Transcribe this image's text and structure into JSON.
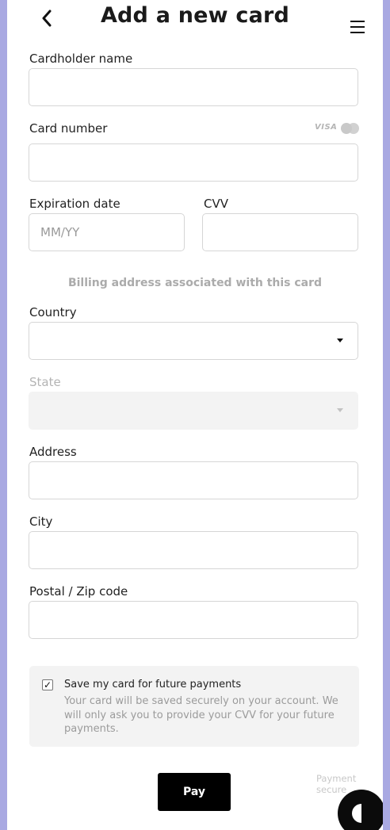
{
  "header": {
    "back_icon": "chevron-left-icon",
    "title": "Add a new card",
    "menu_icon": "hamburger-menu-icon"
  },
  "form": {
    "cardholder_label": "Cardholder name",
    "card_number_label": "Card number",
    "card_brands": [
      "VISA",
      "mastercard-icon"
    ],
    "expiration_label": "Expiration date",
    "expiration_placeholder": "MM/YY",
    "cvv_label": "CVV",
    "billing_heading": "Billing address associated with this card",
    "country_label": "Country",
    "country_value": "",
    "state_label": "State",
    "address_label": "Address",
    "city_label": "City",
    "postal_label": "Postal / Zip code"
  },
  "save_card": {
    "checked": true,
    "label": "Save my card for future payments",
    "note": "Your card will be saved securely on your account. We will only ask you to provide your CVV for your future payments."
  },
  "footer": {
    "pay_label": "Pay",
    "secure_text": "Payment secure"
  },
  "colors": {
    "backdrop": "#a9a9e2",
    "panel": "#ffffff",
    "button": "#000000"
  }
}
